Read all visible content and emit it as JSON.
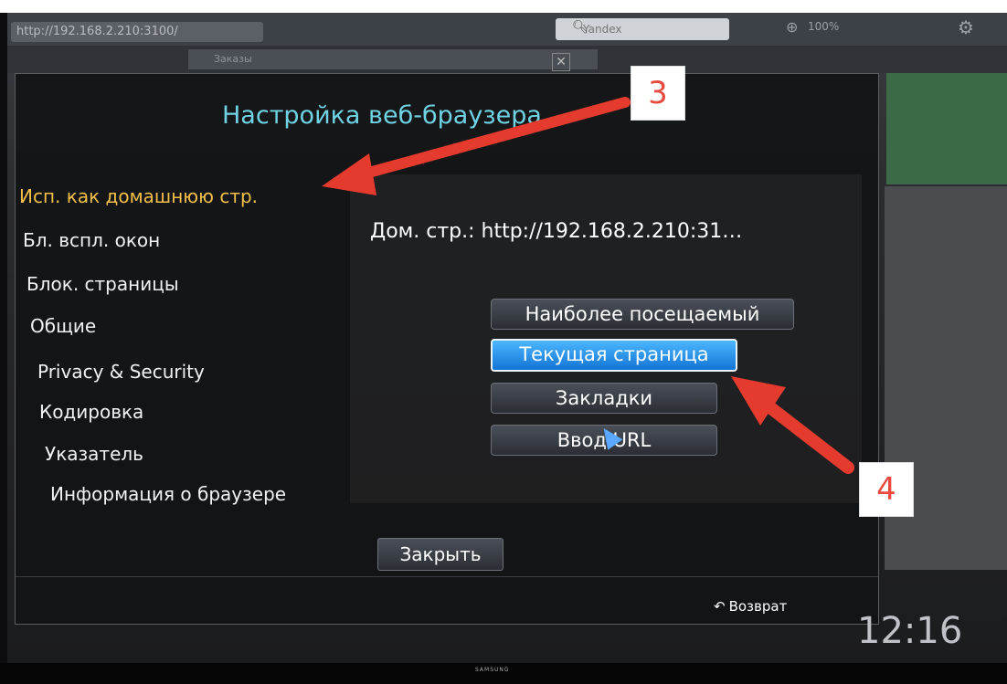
{
  "browser": {
    "url": "http://192.168.2.210:3100/",
    "search_placeholder": "Yandex",
    "zoom": "100%",
    "tab_title": "Заказы"
  },
  "dialog": {
    "title": "Настройка веб-браузера",
    "menu": [
      {
        "label": "Исп. как домашнюю стр.",
        "active": true
      },
      {
        "label": "Бл. вспл. окон",
        "active": false
      },
      {
        "label": "Блок. страницы",
        "active": false
      },
      {
        "label": "Общие",
        "active": false
      },
      {
        "label": "Privacy & Security",
        "active": false
      },
      {
        "label": "Кодировка",
        "active": false
      },
      {
        "label": "Указатель",
        "active": false
      },
      {
        "label": "Информация о браузере",
        "active": false
      }
    ],
    "homepage_label": "Дом. стр.: http://192.168.2.210:31…",
    "options": [
      {
        "label": "Наиболее посещаемый",
        "selected": false
      },
      {
        "label": "Текущая страница",
        "selected": true
      },
      {
        "label": "Закладки",
        "selected": false
      },
      {
        "label": "Ввод URL",
        "selected": false
      }
    ],
    "close_label": "Закрыть",
    "back_label": "Возврат"
  },
  "tv": {
    "clock": "12:16",
    "brand": "SAMSUNG"
  },
  "annotations": {
    "step3": "3",
    "step4": "4",
    "arrow_color": "#e53b2f"
  },
  "icons": {
    "search": "search-icon",
    "zoom": "zoom-icon",
    "settings": "gear-icon",
    "back": "back-arrow-icon",
    "tab_close": "close-icon",
    "cursor": "pointer-cursor-icon"
  }
}
